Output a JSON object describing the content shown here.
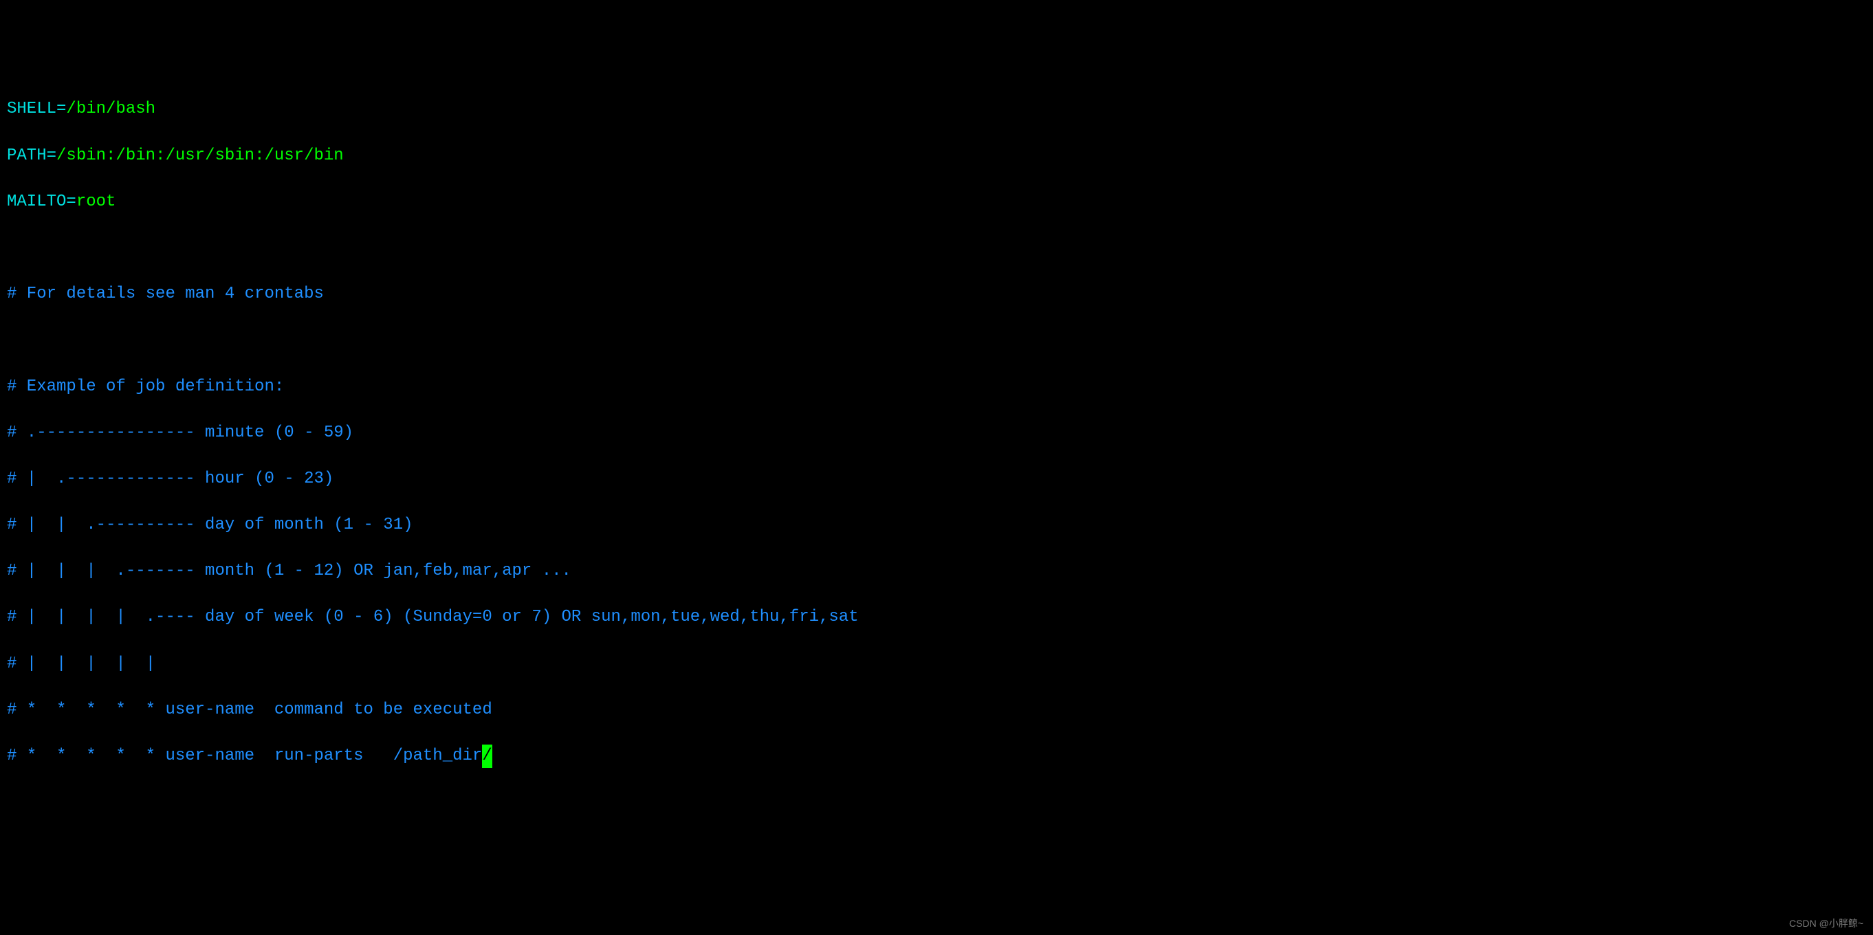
{
  "env": {
    "shell_key": "SHELL",
    "shell_sep": "=",
    "shell_val": "/bin/bash",
    "path_key": "PATH",
    "path_sep": "=",
    "path_val": "/sbin:/bin:/usr/sbin:/usr/bin",
    "mailto_key": "MAILTO",
    "mailto_sep": "=",
    "mailto_val": "root"
  },
  "comments": {
    "details": "# For details see man 4 crontabs",
    "example_header": "# Example of job definition:",
    "minute": "# .---------------- minute (0 - 59)",
    "hour": "# |  .------------- hour (0 - 23)",
    "dom": "# |  |  .---------- day of month (1 - 31)",
    "month": "# |  |  |  .------- month (1 - 12) OR jan,feb,mar,apr ...",
    "dow": "# |  |  |  |  .---- day of week (0 - 6) (Sunday=0 or 7) OR sun,mon,tue,wed,thu,fri,sat",
    "pipes": "# |  |  |  |  |",
    "command": "# *  *  *  *  * user-name  command to be executed",
    "runparts_prefix": "# *  *  *  *  * user-name  run-parts   /path_dir",
    "cursor_char": "/"
  },
  "watermark": "CSDN @小胖鲸~"
}
